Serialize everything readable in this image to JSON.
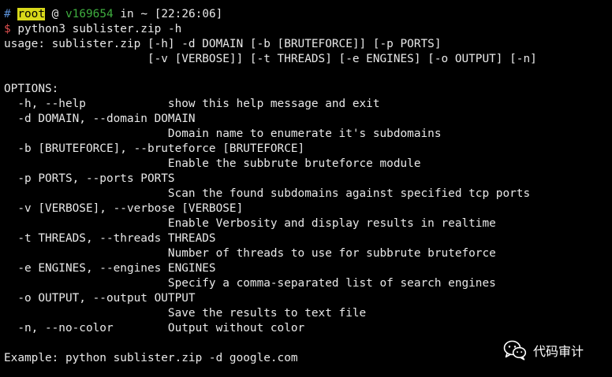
{
  "prompt": {
    "hash": "#",
    "user": "root",
    "at": "@",
    "host": "v169654",
    "in_word": "in",
    "dir": "~",
    "time": "[22:26:06]"
  },
  "command": {
    "symbol": "$",
    "text": "python3 sublister.zip -h"
  },
  "output": {
    "lines": [
      "usage: sublister.zip [-h] -d DOMAIN [-b [BRUTEFORCE]] [-p PORTS]",
      "                     [-v [VERBOSE]] [-t THREADS] [-e ENGINES] [-o OUTPUT] [-n]",
      "",
      "OPTIONS:",
      "  -h, --help            show this help message and exit",
      "  -d DOMAIN, --domain DOMAIN",
      "                        Domain name to enumerate it's subdomains",
      "  -b [BRUTEFORCE], --bruteforce [BRUTEFORCE]",
      "                        Enable the subbrute bruteforce module",
      "  -p PORTS, --ports PORTS",
      "                        Scan the found subdomains against specified tcp ports",
      "  -v [VERBOSE], --verbose [VERBOSE]",
      "                        Enable Verbosity and display results in realtime",
      "  -t THREADS, --threads THREADS",
      "                        Number of threads to use for subbrute bruteforce",
      "  -e ENGINES, --engines ENGINES",
      "                        Specify a comma-separated list of search engines",
      "  -o OUTPUT, --output OUTPUT",
      "                        Save the results to text file",
      "  -n, --no-color        Output without color",
      "",
      "Example: python sublister.zip -d google.com"
    ]
  },
  "watermark": {
    "icon": "wechat-icon",
    "text": "代码审计"
  },
  "colors": {
    "background": "#000000",
    "foreground": "#e8e8e8",
    "hash": "#5a8fd6",
    "user_highlight": "#d8d81a",
    "host": "#3fae3f",
    "dollar": "#e05050"
  }
}
